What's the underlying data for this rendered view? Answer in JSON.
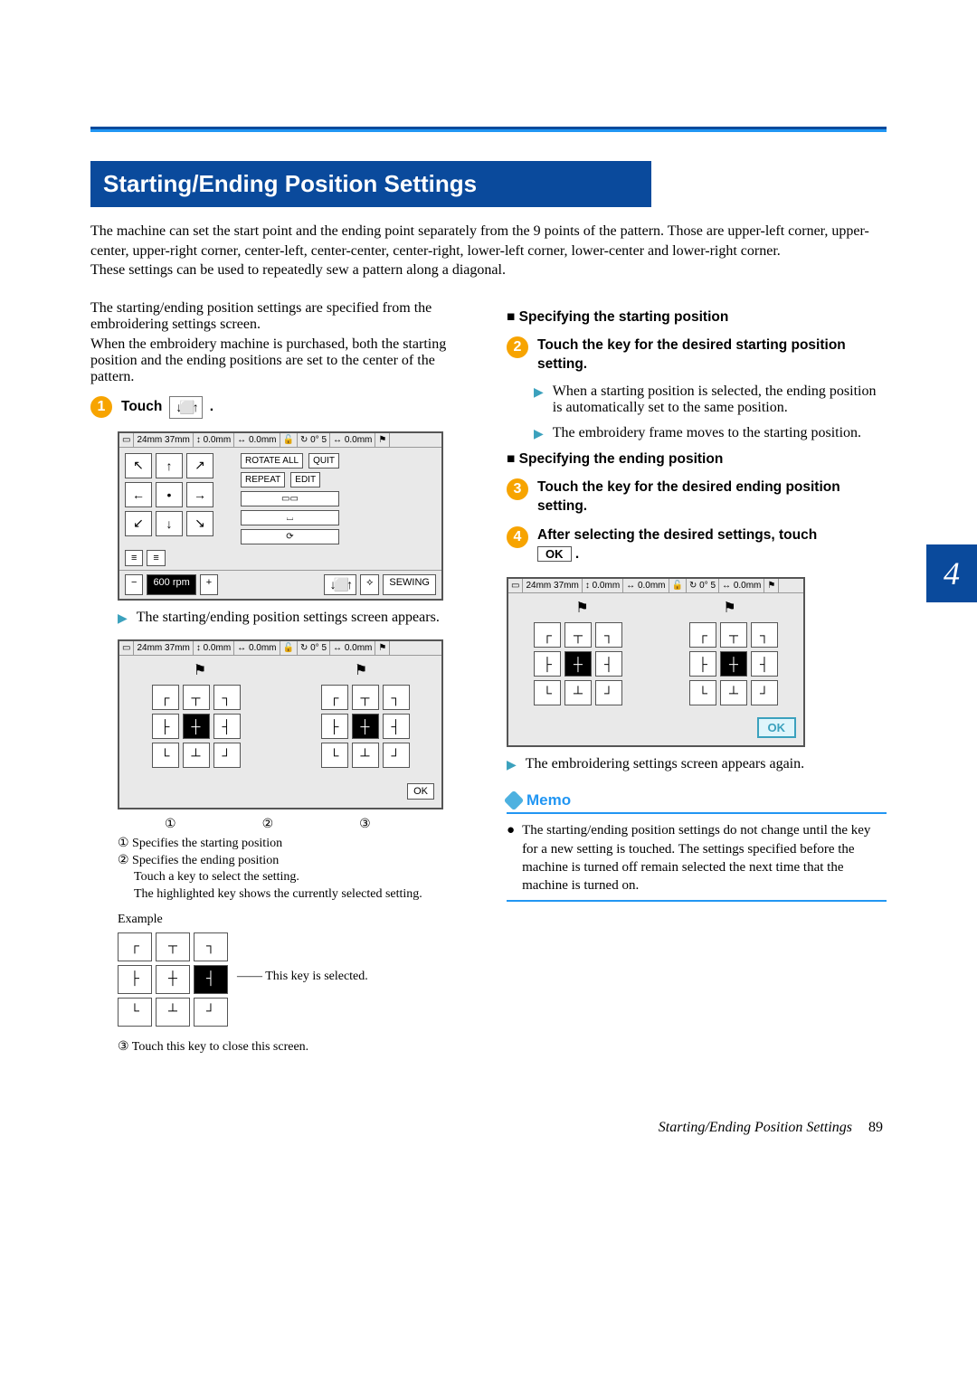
{
  "topStripe": {
    "colorTop": "#0a4a9c",
    "colorBottom": "#2196f3"
  },
  "banner": "Starting/Ending Position Settings",
  "intro": "The machine can set the start point and the ending point separately from the 9 points of the pattern. Those are upper-left corner, upper-center, upper-right corner, center-left, center-center, center-right, lower-left corner, lower-center and lower-right corner.\nThese settings can be used to repeatedly sew a pattern along a diagonal.",
  "left": {
    "para1": "The starting/ending position settings are specified from the embroidering settings screen.",
    "para2": "When the embroidery machine is purchased, both the starting position and the ending positions are set to the center of the pattern.",
    "step1": {
      "num": "1",
      "label": "Touch",
      "iconName": "↓⬜↑",
      "period": "."
    },
    "lcd1": {
      "status": {
        "size": "24mm 37mm",
        "hmm": "0.0mm",
        "vmm": "0.0mm",
        "deg": "0°",
        "deg2": "5",
        "gmm": "0.0mm"
      },
      "sideButtons": [
        "ROTATE ALL",
        "QUIT",
        "REPEAT",
        "EDIT"
      ],
      "bottom": {
        "minus": "−",
        "rpm": "600 rpm",
        "plus": "+",
        "sew": "SEWING"
      }
    },
    "arrow1": "The starting/ending position settings screen appears.",
    "lcd2": {
      "status": {
        "size": "24mm 37mm",
        "hmm": "0.0mm",
        "vmm": "0.0mm",
        "deg": "0°",
        "deg2": "5",
        "gmm": "0.0mm"
      },
      "ok": "OK"
    },
    "circles": [
      "①",
      "②",
      "③"
    ],
    "defs": [
      "① Specifies the starting position",
      "② Specifies the ending position",
      "   Touch a key to select the setting.",
      "   The highlighted key shows the currently selected setting."
    ],
    "exampleLabel": "Example",
    "exampleNote": "This key is selected.",
    "def3": "③ Touch this key to close this screen."
  },
  "right": {
    "h1": "Specifying the starting position",
    "step2": {
      "num": "2",
      "text": "Touch the key for the desired starting position setting."
    },
    "arrow2a": "When a starting position is selected, the ending position is automatically set to the same position.",
    "arrow2b": "The embroidery frame moves to the starting position.",
    "h2": "Specifying the ending position",
    "step3": {
      "num": "3",
      "text": "Touch the key for the desired ending position setting."
    },
    "step4": {
      "num": "4",
      "text": "After selecting the desired settings, touch",
      "ok": "OK",
      "period": "."
    },
    "lcd3": {
      "status": {
        "size": "24mm 37mm",
        "hmm": "0.0mm",
        "vmm": "0.0mm",
        "deg": "0°",
        "deg2": "5",
        "gmm": "0.0mm"
      },
      "ok": "OK"
    },
    "arrow3": "The embroidering settings screen appears again.",
    "memo": {
      "title": "Memo",
      "body": "The starting/ending position settings do not change until the key for a new setting is touched. The settings specified before the machine is turned off remain selected the next time that the machine is turned on."
    },
    "tab": "4"
  },
  "footer": {
    "text": "Starting/Ending Position Settings",
    "page": "89"
  }
}
